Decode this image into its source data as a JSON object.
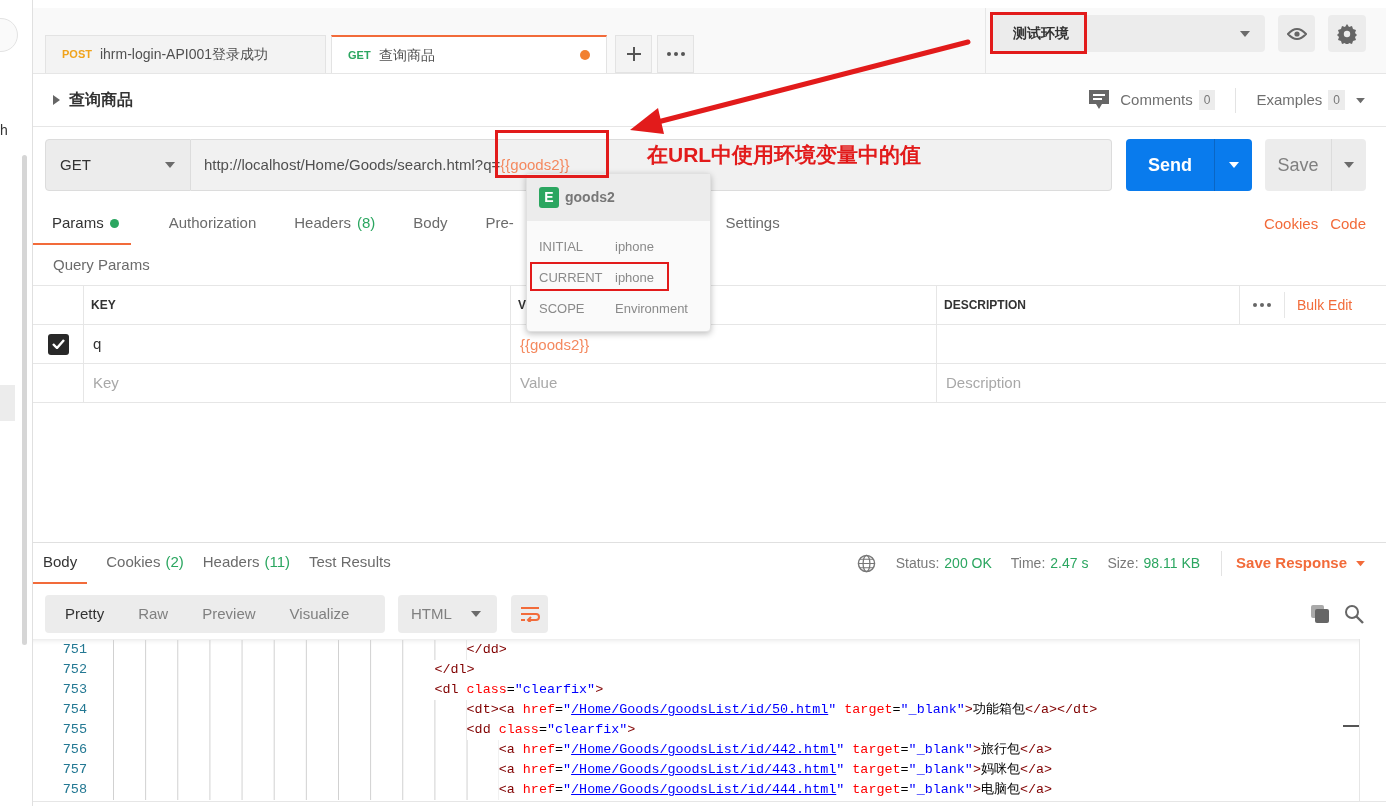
{
  "sidebar_fragment": "h",
  "tabs": [
    {
      "method": "POST",
      "color": "#f0a31b",
      "title": "ihrm-login-API001登录成功",
      "selected": false,
      "unsaved": false
    },
    {
      "method": "GET",
      "color": "#2ba660",
      "title": "查询商品",
      "selected": true,
      "unsaved": true
    }
  ],
  "environment": {
    "selected": "测试环境"
  },
  "request": {
    "name": "查询商品",
    "comments_label": "Comments",
    "comments_count": "0",
    "examples_label": "Examples",
    "examples_count": "0",
    "method": "GET",
    "url": "http://localhost/Home/Goods/search.html?q=",
    "url_variable": "{{goods2}}",
    "send": "Send",
    "save": "Save"
  },
  "request_tabs": [
    {
      "label": "Params",
      "dot": true,
      "selected": true
    },
    {
      "label": "Authorization",
      "selected": false
    },
    {
      "label": "Headers",
      "count": "(8)",
      "selected": false
    },
    {
      "label": "Body",
      "selected": false
    },
    {
      "label": "Pre-",
      "kind": "covered",
      "selected": false
    },
    {
      "label": "Settings",
      "selected": false
    }
  ],
  "request_links": [
    "Cookies",
    "Code"
  ],
  "params": {
    "title": "Query Params",
    "columns": [
      "KEY",
      "V",
      "DESCRIPTION"
    ],
    "bulk_edit": "Bulk Edit",
    "rows": [
      {
        "checked": true,
        "key": "q",
        "value": "{{goods2}}"
      }
    ],
    "placeholders": {
      "key": "Key",
      "value": "Value",
      "description": "Description"
    }
  },
  "variable_popup": {
    "badge": "E",
    "name": "goods2",
    "rows": [
      {
        "label": "INITIAL",
        "value": "iphone",
        "highlighted": false
      },
      {
        "label": "CURRENT",
        "value": "iphone",
        "highlighted": true
      },
      {
        "label": "SCOPE",
        "value": "Environment",
        "highlighted": false
      }
    ]
  },
  "response": {
    "tabs": [
      {
        "label": "Body",
        "selected": true
      },
      {
        "label": "Cookies",
        "count": "(2)",
        "selected": false
      },
      {
        "label": "Headers",
        "count": "(11)",
        "selected": false
      },
      {
        "label": "Test Results",
        "selected": false
      }
    ],
    "status": [
      {
        "label": "Status:",
        "value": "200 OK"
      },
      {
        "label": "Time:",
        "value": "2.47 s"
      },
      {
        "label": "Size:",
        "value": "98.11 KB"
      }
    ],
    "save_response": "Save Response",
    "view_modes": [
      {
        "label": "Pretty",
        "selected": true
      },
      {
        "label": "Raw",
        "selected": false
      },
      {
        "label": "Preview",
        "selected": false
      },
      {
        "label": "Visualize",
        "selected": false
      }
    ],
    "format": "HTML",
    "code": [
      {
        "number": "751",
        "tokens": [
          {
            "kind": "tag",
            "t": "                                            </dd>"
          }
        ]
      },
      {
        "number": "752",
        "tokens": [
          {
            "kind": "tag",
            "t": "                                        </dl>"
          }
        ]
      },
      {
        "number": "753",
        "tokens": [
          {
            "kind": "tag",
            "t": "                                        <dl"
          },
          {
            "kind": "attr",
            "t": " class"
          },
          {
            "kind": "plain",
            "t": "="
          },
          {
            "kind": "str",
            "t": "\"clearfix\""
          },
          {
            "kind": "tag",
            "t": ">"
          }
        ]
      },
      {
        "number": "754",
        "tokens": [
          {
            "kind": "tag",
            "t": "                                            <dt><a"
          },
          {
            "kind": "attr",
            "t": " href"
          },
          {
            "kind": "plain",
            "t": "="
          },
          {
            "kind": "str",
            "t": "\""
          },
          {
            "kind": "url",
            "t": "/Home/Goods/goodsList/id/50.html"
          },
          {
            "kind": "str",
            "t": "\""
          },
          {
            "kind": "attr",
            "t": " target"
          },
          {
            "kind": "plain",
            "t": "="
          },
          {
            "kind": "str",
            "t": "\"_blank\""
          },
          {
            "kind": "tag",
            "t": ">"
          },
          {
            "kind": "plain",
            "t": "功能箱包"
          },
          {
            "kind": "tag",
            "t": "</a></dt>"
          }
        ]
      },
      {
        "number": "755",
        "tokens": [
          {
            "kind": "tag",
            "t": "                                            <dd"
          },
          {
            "kind": "attr",
            "t": " class"
          },
          {
            "kind": "plain",
            "t": "="
          },
          {
            "kind": "str",
            "t": "\"clearfix\""
          },
          {
            "kind": "tag",
            "t": ">"
          }
        ]
      },
      {
        "number": "756",
        "tokens": [
          {
            "kind": "tag",
            "t": "                                                <a"
          },
          {
            "kind": "attr",
            "t": " href"
          },
          {
            "kind": "plain",
            "t": "="
          },
          {
            "kind": "str",
            "t": "\""
          },
          {
            "kind": "url",
            "t": "/Home/Goods/goodsList/id/442.html"
          },
          {
            "kind": "str",
            "t": "\""
          },
          {
            "kind": "attr",
            "t": " target"
          },
          {
            "kind": "plain",
            "t": "="
          },
          {
            "kind": "str",
            "t": "\"_blank\""
          },
          {
            "kind": "tag",
            "t": ">"
          },
          {
            "kind": "plain",
            "t": "旅行包"
          },
          {
            "kind": "tag",
            "t": "</a>"
          }
        ]
      },
      {
        "number": "757",
        "tokens": [
          {
            "kind": "tag",
            "t": "                                                <a"
          },
          {
            "kind": "attr",
            "t": " href"
          },
          {
            "kind": "plain",
            "t": "="
          },
          {
            "kind": "str",
            "t": "\""
          },
          {
            "kind": "url",
            "t": "/Home/Goods/goodsList/id/443.html"
          },
          {
            "kind": "str",
            "t": "\""
          },
          {
            "kind": "attr",
            "t": " target"
          },
          {
            "kind": "plain",
            "t": "="
          },
          {
            "kind": "str",
            "t": "\"_blank\""
          },
          {
            "kind": "tag",
            "t": ">"
          },
          {
            "kind": "plain",
            "t": "妈咪包"
          },
          {
            "kind": "tag",
            "t": "</a>"
          }
        ]
      },
      {
        "number": "758",
        "tokens": [
          {
            "kind": "tag",
            "t": "                                                <a"
          },
          {
            "kind": "attr",
            "t": " href"
          },
          {
            "kind": "plain",
            "t": "="
          },
          {
            "kind": "str",
            "t": "\""
          },
          {
            "kind": "url",
            "t": "/Home/Goods/goodsList/id/444.html"
          },
          {
            "kind": "str",
            "t": "\""
          },
          {
            "kind": "attr",
            "t": " target"
          },
          {
            "kind": "plain",
            "t": "="
          },
          {
            "kind": "str",
            "t": "\"_blank\""
          },
          {
            "kind": "tag",
            "t": ">"
          },
          {
            "kind": "plain",
            "t": "电脑包"
          },
          {
            "kind": "tag",
            "t": "</a>"
          }
        ]
      }
    ]
  },
  "annotation": {
    "callout": "在URL中使用环境变量中的值"
  }
}
